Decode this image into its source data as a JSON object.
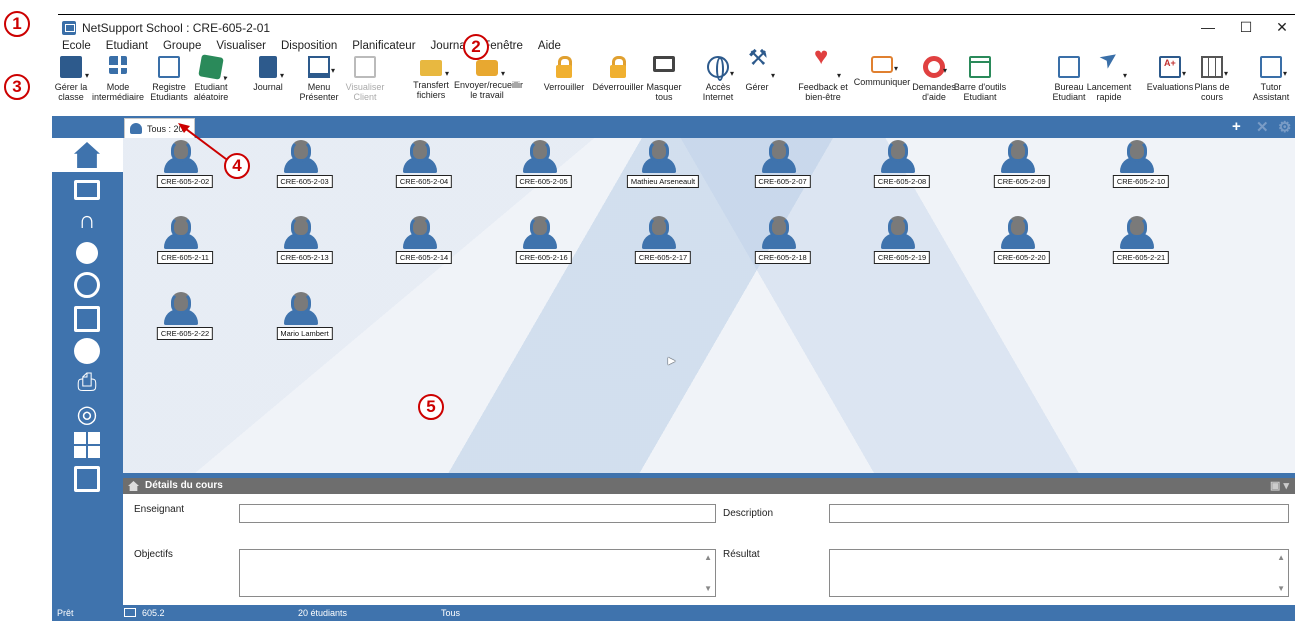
{
  "window": {
    "title": "NetSupport School : CRE-605-2-01",
    "minimize": "—",
    "maximize": "☐",
    "close": "✕"
  },
  "callouts": [
    "1",
    "2",
    "3",
    "4",
    "5"
  ],
  "menu": [
    "Ecole",
    "Etudiant",
    "Groupe",
    "Visualiser",
    "Disposition",
    "Planificateur",
    "Journal",
    "Fenêtre",
    "Aide"
  ],
  "toolbar": [
    {
      "line1": "Gérer la",
      "line2": "classe",
      "icon": "manage-class-icon"
    },
    {
      "line1": "Mode",
      "line2": "intermédiaire",
      "icon": "grid-icon"
    },
    {
      "line1": "Registre",
      "line2": "Etudiants",
      "icon": "register-icon"
    },
    {
      "line1": "Etudiant",
      "line2": "aléatoire",
      "icon": "dice-icon"
    },
    {
      "line1": "Journal",
      "line2": "",
      "icon": "journal-icon"
    },
    {
      "line1": "Menu",
      "line2": "Présenter",
      "icon": "present-icon"
    },
    {
      "line1": "Visualiser",
      "line2": "Client",
      "icon": "view-client-icon"
    },
    {
      "line1": "Transfert",
      "line2": "fichiers",
      "icon": "file-transfer-icon"
    },
    {
      "line1": "Envoyer/recueillir",
      "line2": "le travail",
      "icon": "send-collect-icon"
    },
    {
      "line1": "Verrouiller",
      "line2": "",
      "icon": "lock-icon"
    },
    {
      "line1": "Déverrouiller",
      "line2": "",
      "icon": "unlock-icon"
    },
    {
      "line1": "Masquer",
      "line2": "tous",
      "icon": "blank-screen-icon"
    },
    {
      "line1": "Accès",
      "line2": "Internet",
      "icon": "globe-icon"
    },
    {
      "line1": "Gérer",
      "line2": "",
      "icon": "manage-tools-icon"
    },
    {
      "line1": "Feedback et",
      "line2": "bien-être",
      "icon": "feedback-icon"
    },
    {
      "line1": "Communiquer",
      "line2": "",
      "icon": "chat-icon"
    },
    {
      "line1": "Demandes",
      "line2": "d'aide",
      "icon": "help-ring-icon"
    },
    {
      "line1": "Barre d'outils",
      "line2": "Etudiant",
      "icon": "toolbar-window-icon"
    },
    {
      "line1": "Bureau",
      "line2": "Etudiant",
      "icon": "student-desktop-icon"
    },
    {
      "line1": "Lancement",
      "line2": "rapide",
      "icon": "quick-launch-icon"
    },
    {
      "line1": "Evaluations",
      "line2": "",
      "icon": "evaluations-icon"
    },
    {
      "line1": "Plans de",
      "line2": "cours",
      "icon": "lesson-plan-icon"
    },
    {
      "line1": "Tutor",
      "line2": "Assistant",
      "icon": "tutor-assistant-icon"
    }
  ],
  "tab": {
    "label": "Tous : 20"
  },
  "sidebar": [
    "home-icon",
    "monitor-icon",
    "headphones-icon",
    "brain-icon",
    "globe-icon",
    "layout-icon",
    "pie-chart-icon",
    "printer-icon",
    "user-disc-icon",
    "keyboard-icon",
    "easel-icon"
  ],
  "students": [
    "CRE-605-2-02",
    "CRE-605-2-03",
    "CRE-605-2-04",
    "CRE-605-2-05",
    "Mathieu Arseneault",
    "CRE-605-2-07",
    "CRE-605-2-08",
    "CRE-605-2-09",
    "CRE-605-2-10",
    "CRE-605-2-11",
    "CRE-605-2-13",
    "CRE-605-2-14",
    "CRE-605-2-16",
    "CRE-605-2-17",
    "CRE-605-2-18",
    "CRE-605-2-19",
    "CRE-605-2-20",
    "CRE-605-2-21",
    "CRE-605-2-22",
    "Mario Lambert"
  ],
  "details": {
    "title": "Détails du cours",
    "teacher_label": "Enseignant",
    "description_label": "Description",
    "objectives_label": "Objectifs",
    "result_label": "Résultat",
    "teacher_value": "",
    "description_value": "",
    "objectives_value": "",
    "result_value": ""
  },
  "status": {
    "state": "Prêt",
    "room": "605.2",
    "count": "20 étudiants",
    "group": "Tous"
  }
}
